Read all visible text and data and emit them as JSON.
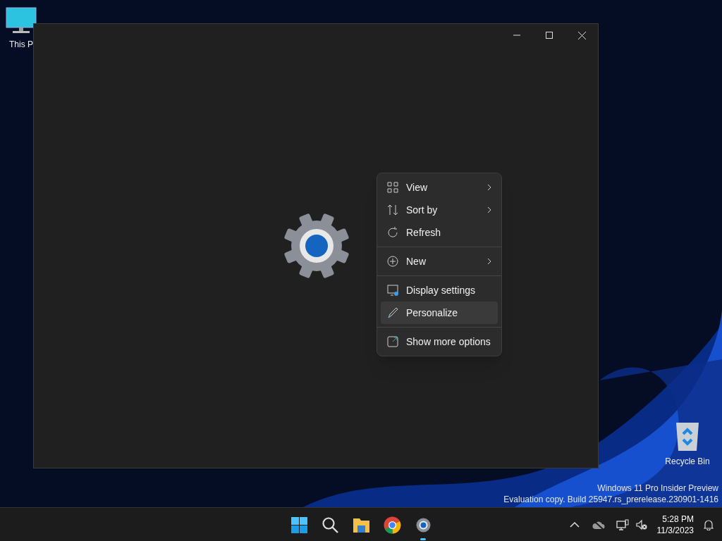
{
  "desktop_icons": [
    {
      "kind": "pc",
      "label": "This P"
    },
    {
      "kind": "bin",
      "label": "Recycle Bin"
    }
  ],
  "context_menu": {
    "groups": [
      [
        {
          "kind": "view",
          "label": "View",
          "submenu": true,
          "selected": false
        },
        {
          "kind": "sort",
          "label": "Sort by",
          "submenu": true,
          "selected": false
        },
        {
          "kind": "refresh",
          "label": "Refresh",
          "submenu": false,
          "selected": false
        }
      ],
      [
        {
          "kind": "new",
          "label": "New",
          "submenu": true,
          "selected": false
        }
      ],
      [
        {
          "kind": "display",
          "label": "Display settings",
          "submenu": false,
          "selected": false
        },
        {
          "kind": "brush",
          "label": "Personalize",
          "submenu": false,
          "selected": true
        }
      ],
      [
        {
          "kind": "more",
          "label": "Show more options",
          "submenu": false,
          "selected": false
        }
      ]
    ]
  },
  "watermark": [
    "Windows 11 Pro Insider Preview",
    "Evaluation copy. Build 25947.rs_prerelease.230901-1416"
  ],
  "taskbar": {
    "apps": [
      {
        "kind": "start",
        "selected": false
      },
      {
        "kind": "search",
        "selected": false
      },
      {
        "kind": "folder",
        "selected": false
      },
      {
        "kind": "chrome",
        "selected": false
      },
      {
        "kind": "settings",
        "selected": true
      }
    ],
    "time": "5:28 PM",
    "date": "11/3/2023"
  }
}
